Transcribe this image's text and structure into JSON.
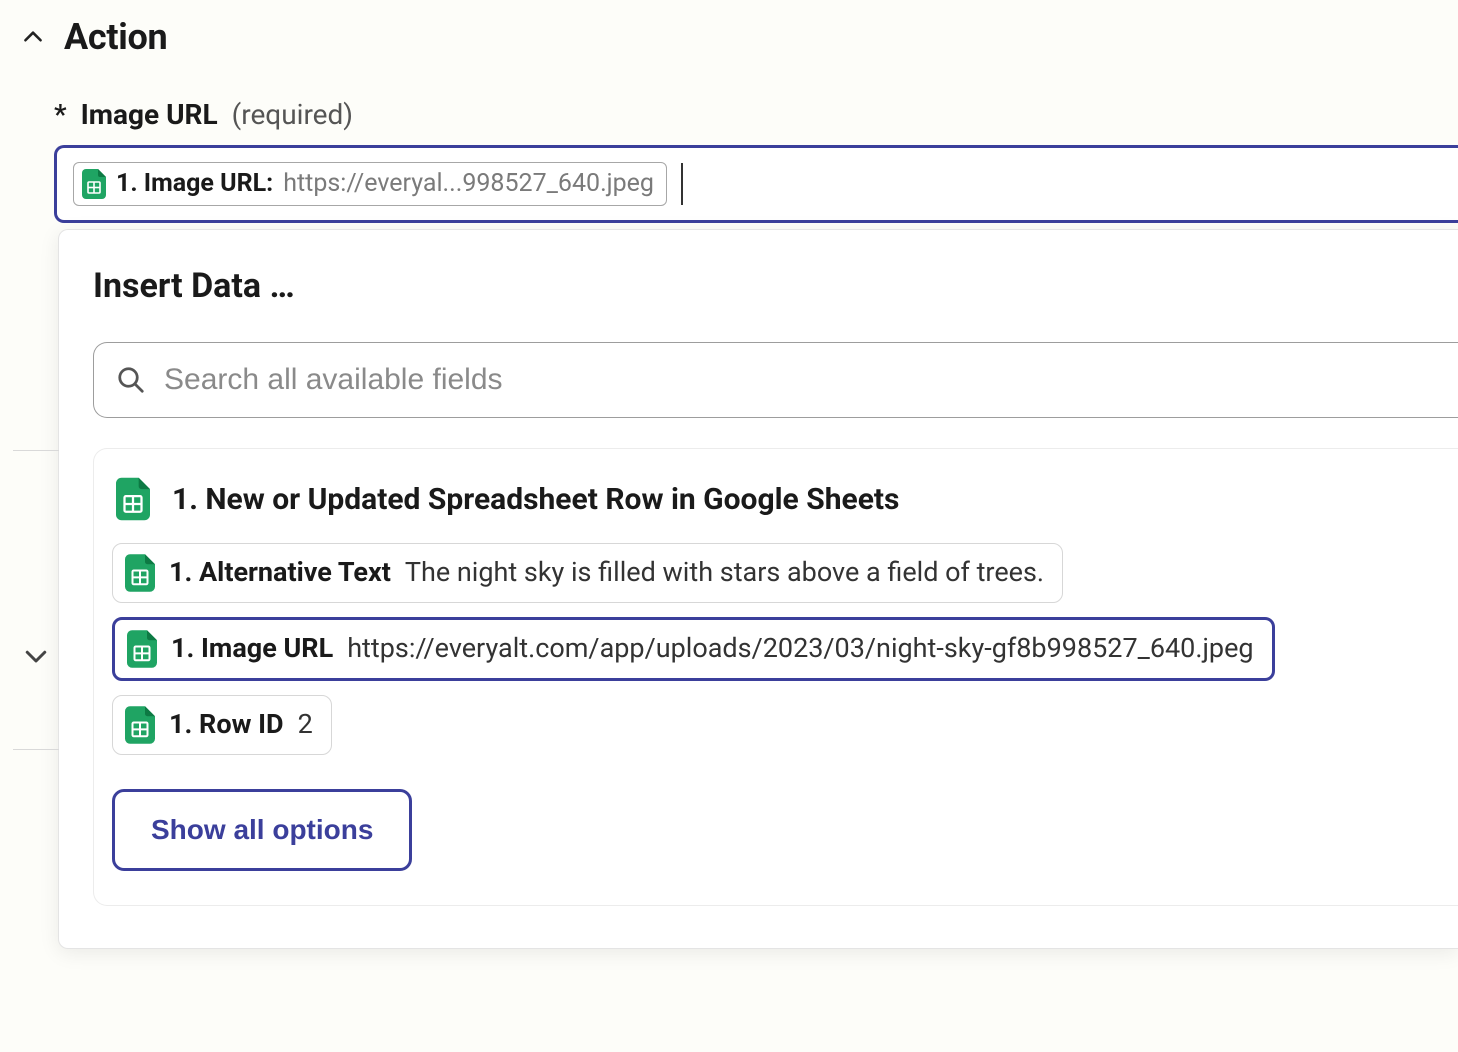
{
  "section": {
    "title": "Action"
  },
  "field": {
    "label": "Image URL",
    "required_marker": "*",
    "required_hint": "(required)",
    "value_pill": {
      "label": "1. Image URL:",
      "value": "https://everyal...998527_640.jpeg"
    }
  },
  "dropdown": {
    "title": "Insert Data …",
    "search_placeholder": "Search all available fields",
    "source_title": "1. New or Updated Spreadsheet Row in Google Sheets",
    "options": [
      {
        "label": "1. Alternative Text",
        "value": "The night sky is filled with stars above a field of trees.",
        "selected": false
      },
      {
        "label": "1. Image URL",
        "value": "https://everyalt.com/app/uploads/2023/03/night-sky-gf8b998527_640.jpeg",
        "selected": true
      },
      {
        "label": "1. Row ID",
        "value": "2",
        "selected": false
      }
    ],
    "show_all_label": "Show all options"
  },
  "colors": {
    "accent": "#3b3f9b",
    "sheets_green": "#1fa463"
  }
}
